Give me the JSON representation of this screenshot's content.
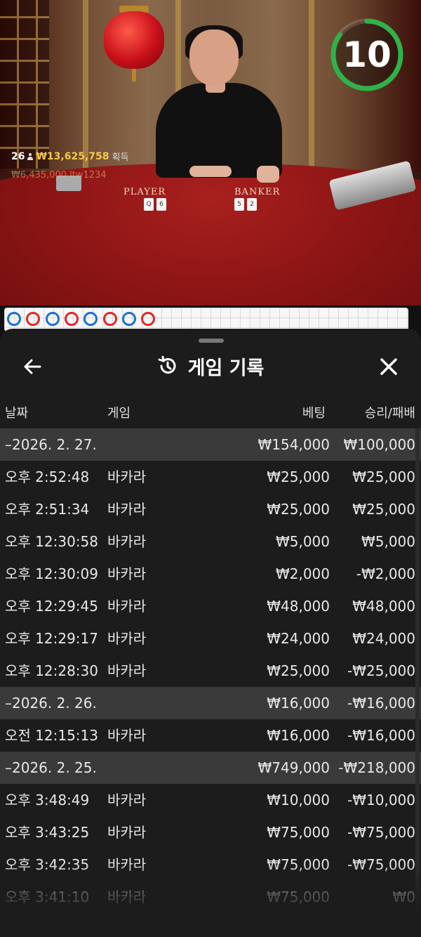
{
  "video": {
    "players_count": "26",
    "total_amount": "₩13,625,758",
    "total_suffix": "획득",
    "win_ticker": "₩6,435,000 ltw1234",
    "player_label": "PLAYER",
    "banker_label": "BANKER",
    "player_cards": [
      "Q",
      "6"
    ],
    "banker_cards": [
      "5",
      "2"
    ],
    "timer": "10",
    "timer_progress": 0.85,
    "timer_color": "#2fb24a"
  },
  "roadmap": {
    "results": [
      "player",
      "banker",
      "player",
      "banker",
      "player",
      "banker",
      "player",
      "banker"
    ],
    "player_color": "#1d6fd6",
    "banker_color": "#e0262b"
  },
  "sheet": {
    "title": "게임 기록",
    "columns": {
      "date": "날짜",
      "game": "게임",
      "bet": "베팅",
      "result": "승리/패배"
    },
    "groups": [
      {
        "date": "–2026. 2. 27.",
        "bet_total": "₩154,000",
        "result_total": "₩100,000",
        "items": [
          {
            "time": "오후 2:52:48",
            "game": "바카라",
            "bet": "₩25,000",
            "result": "₩25,000"
          },
          {
            "time": "오후 2:51:34",
            "game": "바카라",
            "bet": "₩25,000",
            "result": "₩25,000"
          },
          {
            "time": "오후 12:30:58",
            "game": "바카라",
            "bet": "₩5,000",
            "result": "₩5,000"
          },
          {
            "time": "오후 12:30:09",
            "game": "바카라",
            "bet": "₩2,000",
            "result": "-₩2,000"
          },
          {
            "time": "오후 12:29:45",
            "game": "바카라",
            "bet": "₩48,000",
            "result": "₩48,000"
          },
          {
            "time": "오후 12:29:17",
            "game": "바카라",
            "bet": "₩24,000",
            "result": "₩24,000"
          },
          {
            "time": "오후 12:28:30",
            "game": "바카라",
            "bet": "₩25,000",
            "result": "-₩25,000"
          }
        ]
      },
      {
        "date": "–2026. 2. 26.",
        "bet_total": "₩16,000",
        "result_total": "-₩16,000",
        "items": [
          {
            "time": "오전 12:15:13",
            "game": "바카라",
            "bet": "₩16,000",
            "result": "-₩16,000"
          }
        ]
      },
      {
        "date": "–2026. 2. 25.",
        "bet_total": "₩749,000",
        "result_total": "-₩218,000",
        "items": [
          {
            "time": "오후 3:48:49",
            "game": "바카라",
            "bet": "₩10,000",
            "result": "-₩10,000"
          },
          {
            "time": "오후 3:43:25",
            "game": "바카라",
            "bet": "₩75,000",
            "result": "-₩75,000"
          },
          {
            "time": "오후 3:42:35",
            "game": "바카라",
            "bet": "₩75,000",
            "result": "-₩75,000"
          },
          {
            "time": "오후 3:41:10",
            "game": "바카라",
            "bet": "₩75,000",
            "result": "₩0"
          }
        ]
      }
    ]
  }
}
